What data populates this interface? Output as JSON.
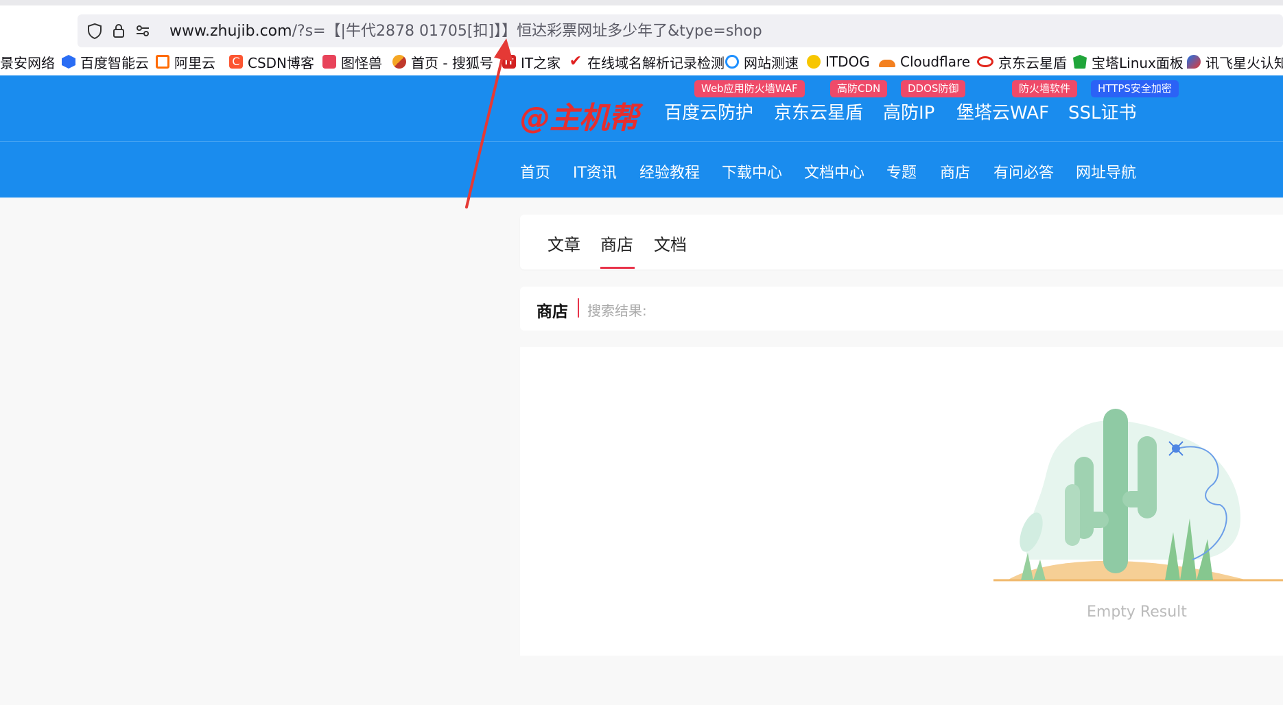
{
  "browser": {
    "url_main": "www.zhujib.com",
    "url_rest_a": "/?s=【|牛代2878 01705[扣]】】",
    "url_rest_b": "恒达彩票网址多少年了&type=shop",
    "icons": [
      "shield-icon",
      "lock-icon",
      "site-settings-icon"
    ]
  },
  "bookmarks": [
    {
      "label": "景安网络",
      "icon": "jingan-icon",
      "color": "#1d6fd6"
    },
    {
      "label": "百度智能云",
      "icon": "baidu-cloud-icon",
      "color": "#2a6df4"
    },
    {
      "label": "阿里云",
      "icon": "aliyun-icon",
      "color": "#ff6a00"
    },
    {
      "label": "CSDN博客",
      "icon": "csdn-icon",
      "color": "#fc5531"
    },
    {
      "label": "图怪兽",
      "icon": "tuguaishou-icon",
      "color": "#e8435a"
    },
    {
      "label": "首页 - 搜狐号",
      "icon": "sohu-icon",
      "color": "#f5a623"
    },
    {
      "label": "IT之家",
      "icon": "ithome-icon",
      "color": "#d22222"
    },
    {
      "label": "在线域名解析记录检测",
      "icon": "check-icon",
      "color": "#e02020"
    },
    {
      "label": "网站测速",
      "icon": "speedtest-icon",
      "color": "#1e90ff"
    },
    {
      "label": "ITDOG",
      "icon": "itdog-icon",
      "color": "#f7c600"
    },
    {
      "label": "Cloudflare",
      "icon": "cloudflare-icon",
      "color": "#f38020"
    },
    {
      "label": "京东云星盾",
      "icon": "jdcloud-icon",
      "color": "#e1251b"
    },
    {
      "label": "宝塔Linux面板",
      "icon": "baota-icon",
      "color": "#20a53a"
    },
    {
      "label": "讯飞星火认知大",
      "icon": "xunfei-icon",
      "color": "#1a73e8"
    }
  ],
  "header": {
    "logo": "@主机帮",
    "promos": [
      "百度云防护",
      "京东云星盾",
      "高防IP",
      "堡塔云WAF",
      "SSL证书"
    ],
    "badges": [
      {
        "label": "Web应用防火墙WAF",
        "tone": "red"
      },
      {
        "label": "高防CDN",
        "tone": "red"
      },
      {
        "label": "DDOS防御",
        "tone": "red"
      },
      {
        "label": "防火墙软件",
        "tone": "red"
      },
      {
        "label": "HTTPS安全加密",
        "tone": "blue"
      }
    ],
    "nav": [
      "首页",
      "IT资讯",
      "经验教程",
      "下载中心",
      "文档中心",
      "专题",
      "商店",
      "有问必答",
      "网址导航"
    ]
  },
  "tabs": [
    "文章",
    "商店",
    "文档"
  ],
  "active_tab": "商店",
  "search": {
    "section": "商店",
    "result_label": "搜索结果:"
  },
  "empty_state": {
    "text": "Empty Result",
    "illustration": "cactus-illustration"
  },
  "colors": {
    "header_blue": "#1a8cee",
    "accent_red": "#e8334a",
    "logo_red": "#e62e2e"
  }
}
